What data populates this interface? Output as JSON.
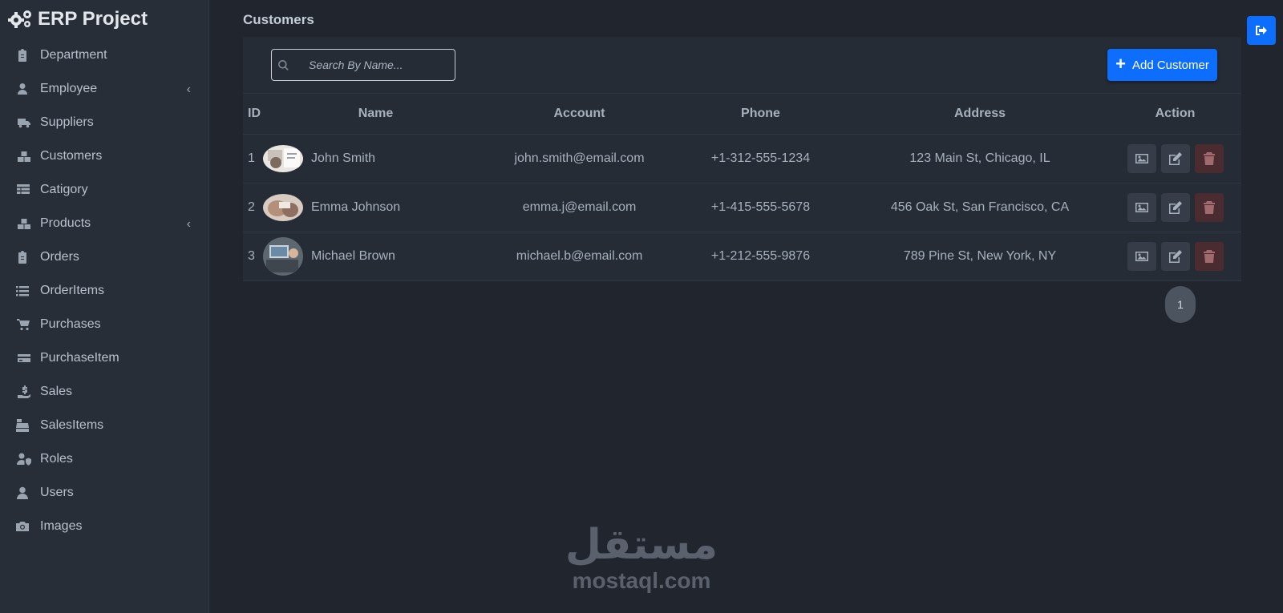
{
  "brand": {
    "title": "ERP Project"
  },
  "sidebar": {
    "items": [
      {
        "label": "Department",
        "icon": "clipboard-icon"
      },
      {
        "label": "Employee",
        "icon": "user-tie-icon",
        "chevron": "‹"
      },
      {
        "label": "Suppliers",
        "icon": "truck-icon"
      },
      {
        "label": "Customers",
        "icon": "boxes-icon"
      },
      {
        "label": "Catigory",
        "icon": "table-icon"
      },
      {
        "label": "Products",
        "icon": "boxes-icon",
        "chevron": "‹"
      },
      {
        "label": "Orders",
        "icon": "clipboard-icon"
      },
      {
        "label": "OrderItems",
        "icon": "list-icon"
      },
      {
        "label": "Purchases",
        "icon": "cart-icon"
      },
      {
        "label": "PurchaseItem",
        "icon": "credit-card-icon"
      },
      {
        "label": "Sales",
        "icon": "hand-dollar-icon"
      },
      {
        "label": "SalesItems",
        "icon": "cash-register-icon"
      },
      {
        "label": "Roles",
        "icon": "user-shield-icon"
      },
      {
        "label": "Users",
        "icon": "user-icon"
      },
      {
        "label": "Images",
        "icon": "camera-icon"
      }
    ]
  },
  "main": {
    "title": "Customers",
    "search": {
      "placeholder": "Search By Name...",
      "value": ""
    },
    "add_button": {
      "label": "Add Customer"
    },
    "table": {
      "headers": [
        "ID",
        "Name",
        "Account",
        "Phone",
        "Address",
        "Action"
      ],
      "rows": [
        {
          "id": "1",
          "name": "John Smith",
          "account": "john.smith@email.com",
          "phone": "+1-312-555-1234",
          "address": "123 Main St, Chicago, IL"
        },
        {
          "id": "2",
          "name": "Emma Johnson",
          "account": "emma.j@email.com",
          "phone": "+1-415-555-5678",
          "address": "456 Oak St, San Francisco, CA"
        },
        {
          "id": "3",
          "name": "Michael Brown",
          "account": "michael.b@email.com",
          "phone": "+1-212-555-9876",
          "address": "789 Pine St, New York, NY"
        }
      ]
    },
    "pagination": {
      "current": "1"
    }
  },
  "watermark": {
    "arabic": "مستقل",
    "latin": "mostaql.com"
  },
  "colors": {
    "accent": "#0d6efd",
    "background": "#21252e",
    "sidebar": "#282e38",
    "danger": "#4a2c30"
  }
}
